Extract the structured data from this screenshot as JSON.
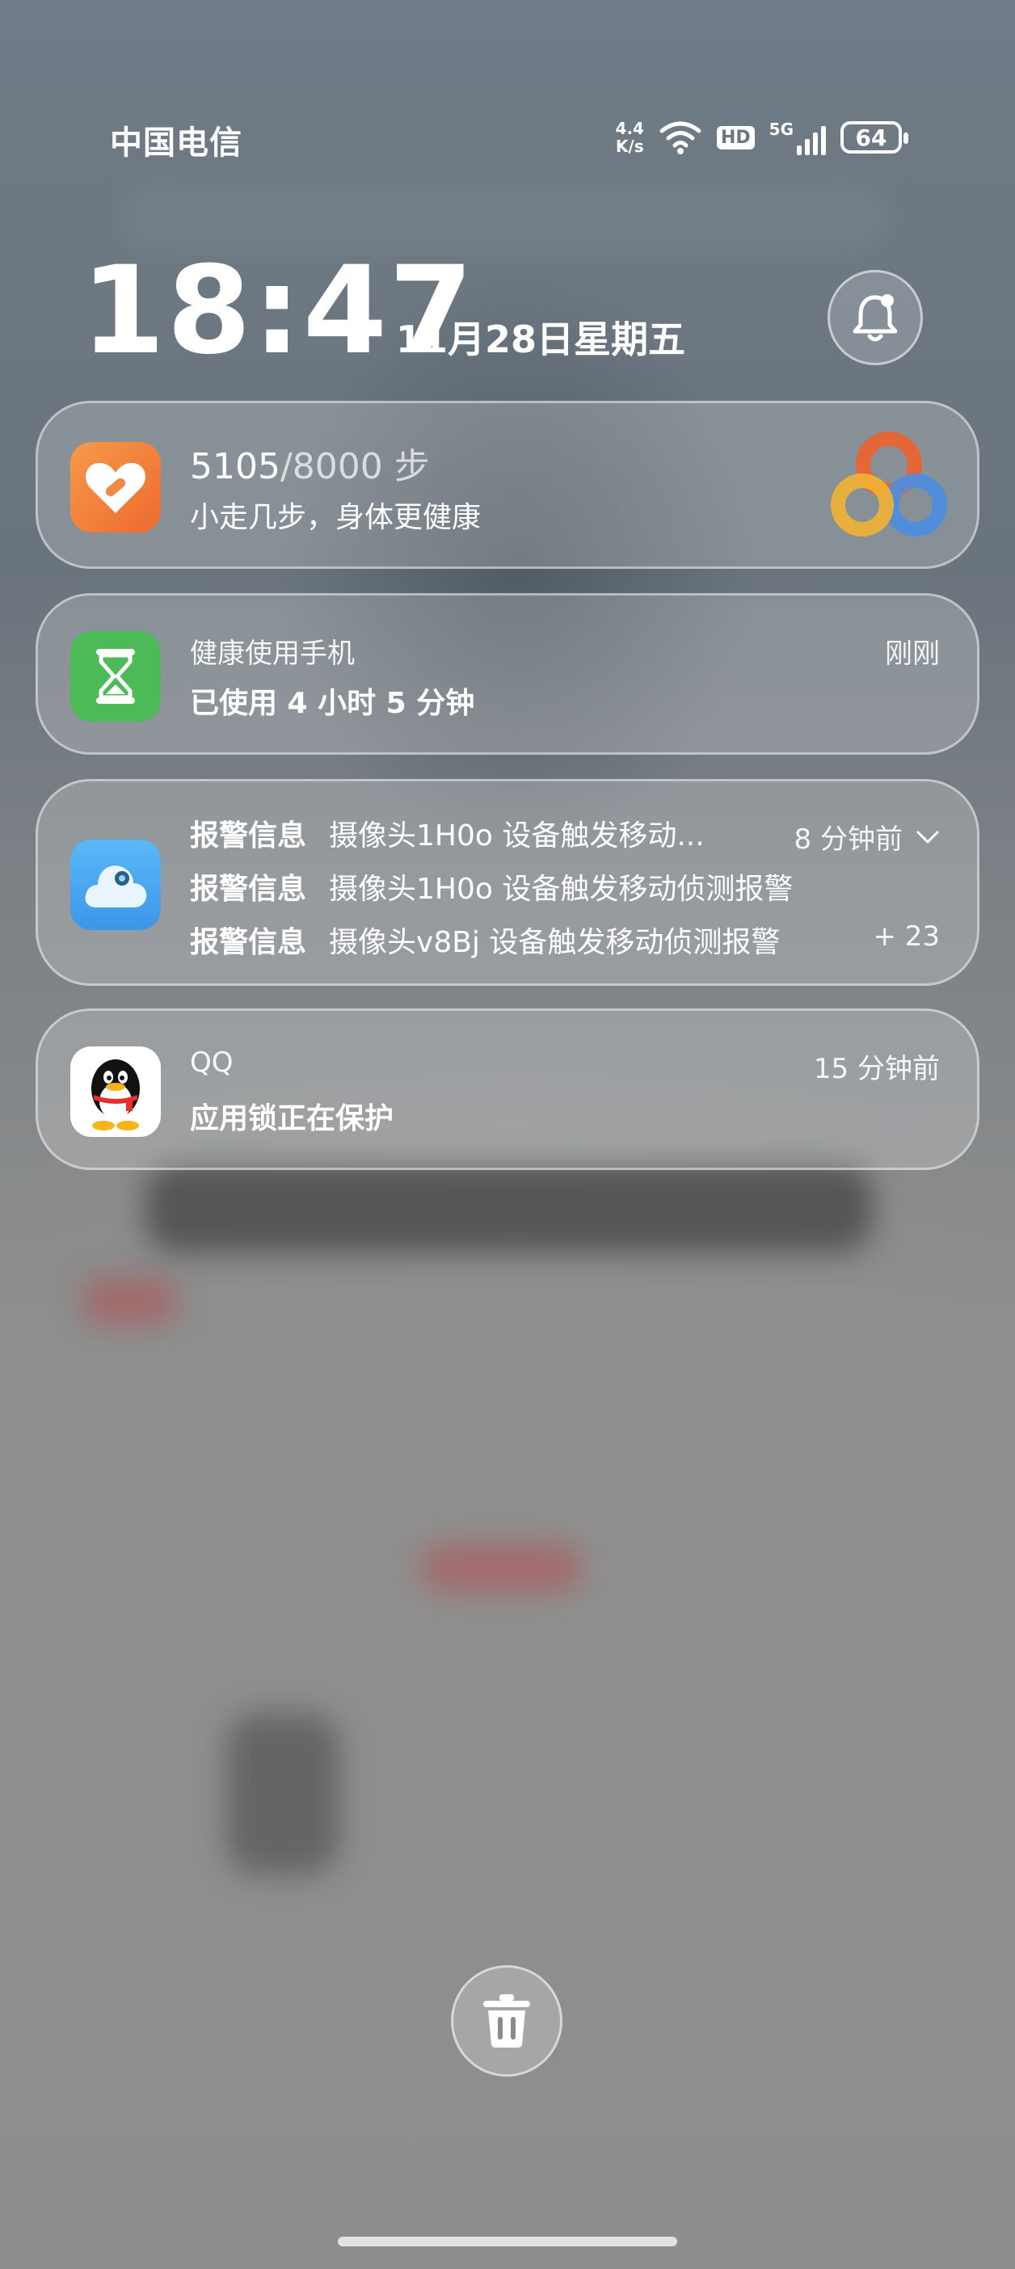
{
  "status_bar": {
    "carrier": "中国电信",
    "speed_top": "4.4",
    "speed_bottom": "K/s",
    "wifi_icon": "wifi-icon",
    "hd_label": "HD",
    "network_label": "5G",
    "battery_level": "64"
  },
  "lock": {
    "time": "18:47",
    "date": "11月28日星期五",
    "bell_icon": "bell-icon"
  },
  "notifications": {
    "health": {
      "steps_current": "5105",
      "steps_goal": "/8000 步",
      "subtitle": "小走几步，身体更健康"
    },
    "screen_time": {
      "app": "健康使用手机",
      "time": "刚刚",
      "body": "已使用 4 小时 5 分钟"
    },
    "alarm": {
      "time": "8 分钟前",
      "more": "+ 23",
      "lines": [
        {
          "label": "报警信息",
          "text": "摄像头1H0o 设备触发移动..."
        },
        {
          "label": "报警信息",
          "text": "摄像头1H0o 设备触发移动侦测报警"
        },
        {
          "label": "报警信息",
          "text": "摄像头v8Bj 设备触发移动侦测报警"
        }
      ]
    },
    "qq": {
      "app": "QQ",
      "time": "15 分钟前",
      "body": "应用锁正在保护"
    }
  },
  "actions": {
    "clear_icon": "trash-icon"
  },
  "colors": {
    "health_icon": "#f27a3a",
    "screen_time_icon": "#4cba56",
    "camera_icon": "#4aa9f2"
  }
}
